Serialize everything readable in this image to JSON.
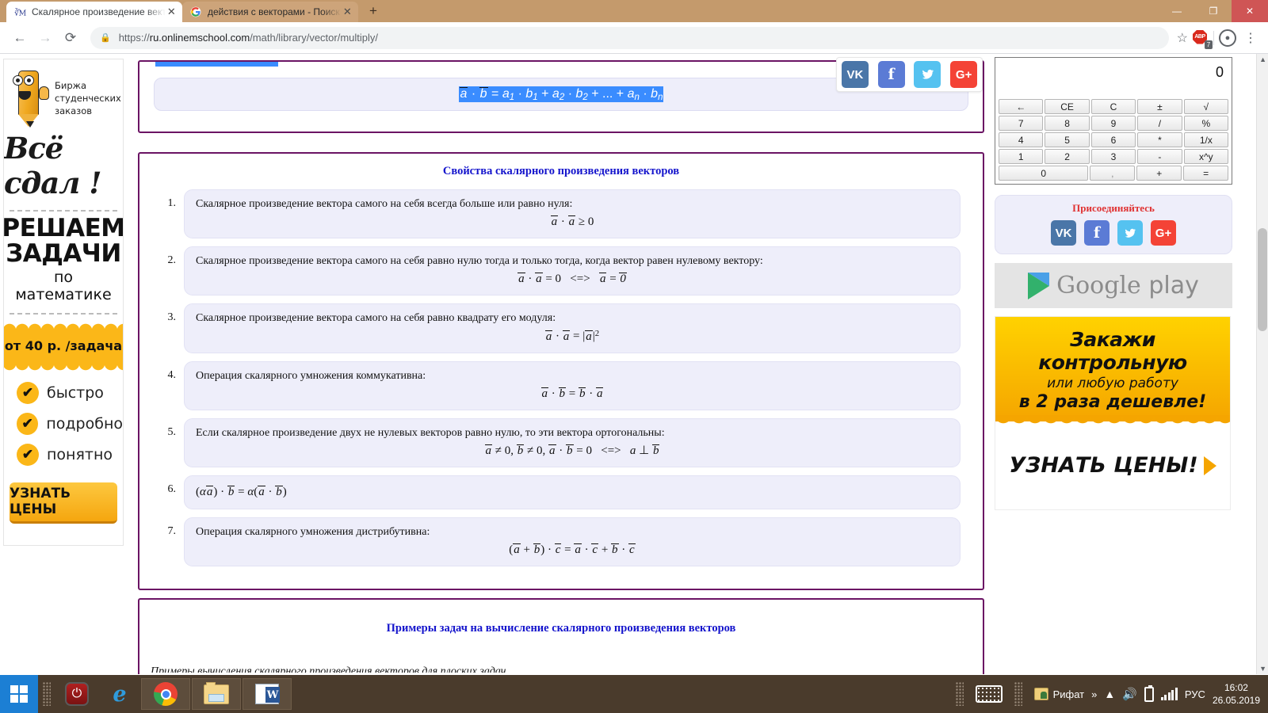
{
  "browser": {
    "tabs": [
      {
        "title": "Скалярное произведение векто",
        "favicon": "math-root-icon",
        "active": true,
        "close": "✕"
      },
      {
        "title": "действия с векторами - Поиск в",
        "favicon": "google-icon",
        "active": false,
        "close": "✕"
      }
    ],
    "new_tab_label": "+",
    "window_controls": {
      "minimize": "—",
      "maximize": "❐",
      "close": "✕"
    },
    "nav": {
      "back": "←",
      "forward": "→",
      "reload": "⟳"
    },
    "omnibox": {
      "lock_icon": "lock-icon",
      "url_scheme": "https://",
      "url_host": "ru.onlinemschool.com",
      "url_path": "/math/library/vector/multiply/"
    },
    "star_icon": "☆",
    "adblock": {
      "label": "ABP",
      "badge": "7"
    },
    "profile_icon": "person-icon",
    "menu_icon": "⋮"
  },
  "left_ad": {
    "brand_line1": "Биржа",
    "brand_line2": "студенческих",
    "brand_line3": "заказов",
    "slogan": "Всё сдал !",
    "headline1": "РЕШАЕМ",
    "headline2": "ЗАДАЧИ",
    "subhead": "по математике",
    "price": "от 40 р. /задача",
    "bullets": [
      "быстро",
      "подробно",
      "понятно"
    ],
    "cta": "УЗНАТЬ ЦЕНЫ",
    "check_glyph": "✔"
  },
  "content": {
    "top_formula": {
      "lhs_a": "a",
      "dot": "·",
      "lhs_b": "b",
      "eq": "=",
      "t1_a": "a",
      "t1_sub": "1",
      "t1_b": "b",
      "t1_bsub": "1",
      "plus1": "+",
      "t2_a": "a",
      "t2_sub": "2",
      "t2_b": "b",
      "t2_bsub": "2",
      "plus2": "+ ... +",
      "t3_a": "a",
      "t3_sub": "n",
      "t3_b": "b",
      "t3_bsub": "n"
    },
    "share_buttons": [
      {
        "name": "vk",
        "glyph": "VK"
      },
      {
        "name": "facebook",
        "glyph": "f"
      },
      {
        "name": "twitter",
        "glyph": "🐦"
      },
      {
        "name": "google-plus",
        "glyph": "G+"
      }
    ],
    "properties_title": "Свойства скалярного произведения векторов",
    "properties": [
      {
        "num": "1.",
        "text": "Скалярное произведение вектора самого на себя всегда больше или равно нуля:",
        "formula_align": "center"
      },
      {
        "num": "2.",
        "text": "Скалярное произведение вектора самого на себя равно нулю тогда и только тогда, когда вектор равен нулевому вектору:",
        "formula_align": "center"
      },
      {
        "num": "3.",
        "text": "Скалярное произведение вектора самого на себя равно квадрату его модуля:",
        "formula_align": "center"
      },
      {
        "num": "4.",
        "text": "Операция скалярного умножения коммукативна:",
        "formula_align": "center"
      },
      {
        "num": "5.",
        "text": "Если скалярное произведение двух не нулевых векторов равно нулю, то эти вектора ортогональны:",
        "formula_align": "center"
      },
      {
        "num": "6.",
        "text": "",
        "formula_align": "left"
      },
      {
        "num": "7.",
        "text": "Операция скалярного умножения дистрибутивна:",
        "formula_align": "center"
      }
    ],
    "formula_symbols": {
      "a": "a",
      "b": "b",
      "c": "c",
      "zero": "0",
      "dot": "·",
      "eq": "=",
      "ge": "≥",
      "ne": "≠",
      "iff": "<=>",
      "perp": "⊥",
      "plus": "+",
      "comma": ",",
      "alpha": "α",
      "bar": "|",
      "sq": "2",
      "lparen": "(",
      "rparen": ")"
    },
    "examples_title": "Примеры задач на вычисление скалярного произведения векторов"
  },
  "right_col": {
    "calculator": {
      "display": "0",
      "rows": [
        [
          "←",
          "CE",
          "C",
          "±",
          "√"
        ],
        [
          "7",
          "8",
          "9",
          "/",
          "%"
        ],
        [
          "4",
          "5",
          "6",
          "*",
          "1/x"
        ],
        [
          "1",
          "2",
          "3",
          "-",
          "x^y"
        ],
        [
          "0",
          ",",
          "+",
          "="
        ]
      ]
    },
    "join": {
      "title": "Присоединяйтесь",
      "icons": [
        {
          "name": "vk",
          "glyph": "VK"
        },
        {
          "name": "facebook",
          "glyph": "f"
        },
        {
          "name": "twitter",
          "glyph": "🐦"
        },
        {
          "name": "google-plus",
          "glyph": "G+"
        }
      ]
    },
    "google_play": {
      "word1": "Google",
      "word2": "play"
    },
    "yellow_ad": {
      "line1": "Закажи контрольную",
      "line2": "или любую работу",
      "line3": "в 2 раза дешевле!",
      "cta": "УЗНАТЬ ЦЕНЫ!"
    }
  },
  "taskbar": {
    "start_icon": "windows-logo-icon",
    "apps": [
      "chrome-icon",
      "folder-icon",
      "word-icon"
    ],
    "shutdown_icon": "power-icon",
    "ie_icon": "internet-explorer-icon",
    "keyboard_icon": "keyboard-icon",
    "user_label": "Рифат",
    "overflow": "»",
    "tray": {
      "show_hidden": "▲",
      "volume_icon": "speaker-icon",
      "battery_icon": "battery-icon",
      "network_icon": "signal-icon",
      "language": "РУС"
    },
    "clock_time": "16:02",
    "clock_date": "26.05.2019"
  }
}
